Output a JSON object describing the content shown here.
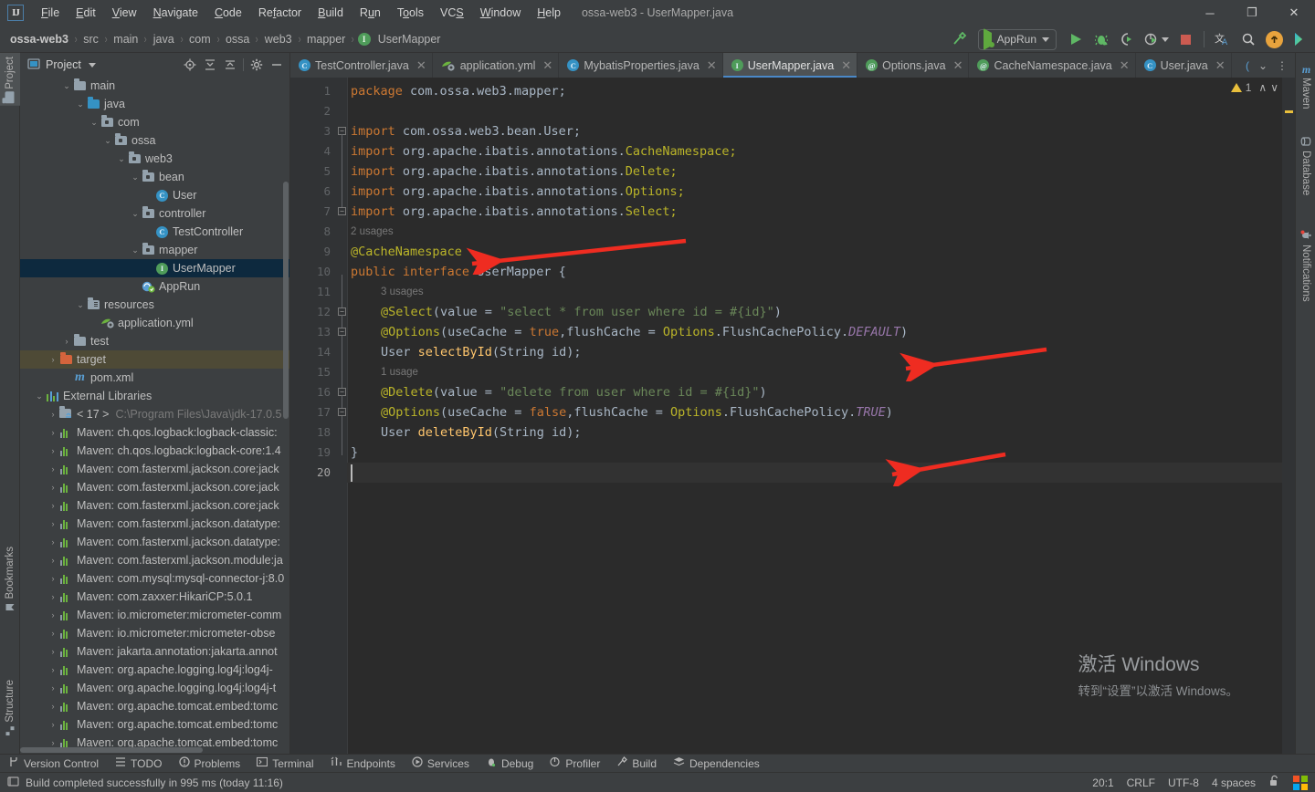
{
  "window": {
    "title": "ossa-web3 - UserMapper.java",
    "logo_text": "IJ",
    "minimize": "─",
    "maximize": "❐",
    "close": "✕"
  },
  "menu": [
    {
      "label": "File"
    },
    {
      "label": "Edit"
    },
    {
      "label": "View"
    },
    {
      "label": "Navigate"
    },
    {
      "label": "Code"
    },
    {
      "label": "Refactor"
    },
    {
      "label": "Build"
    },
    {
      "label": "Run"
    },
    {
      "label": "Tools"
    },
    {
      "label": "VCS"
    },
    {
      "label": "Window"
    },
    {
      "label": "Help"
    }
  ],
  "breadcrumb": {
    "items": [
      "ossa-web3",
      "src",
      "main",
      "java",
      "com",
      "ossa",
      "web3",
      "mapper"
    ],
    "last": "UserMapper",
    "last_icon": "I",
    "separator": "›"
  },
  "run_toolbar": {
    "build_icon": "hammer-icon",
    "config_name": "AppRun",
    "run_icon": "run-icon",
    "debug_icon": "debug-icon",
    "run_with_coverage_icon": "coverage-icon",
    "profile_icon": "profiler-icon",
    "stop_icon": "stop-icon",
    "translate_icon": "translate-icon",
    "search_icon": "search-icon",
    "update_icon": "update-icon",
    "ide_icon": "ide-icon"
  },
  "left_strip": [
    {
      "label": "Project",
      "icon": "project-icon",
      "active": true
    },
    {
      "label": "Bookmarks",
      "icon": "bookmark-icon",
      "active": false
    },
    {
      "label": "Structure",
      "icon": "structure-icon",
      "active": false
    }
  ],
  "right_strip": [
    {
      "label": "Maven",
      "icon": "maven-icon"
    },
    {
      "label": "Database",
      "icon": "database-icon"
    },
    {
      "label": "Notifications",
      "icon": "notifications-icon"
    }
  ],
  "project_pane": {
    "title": "Project",
    "icons": [
      "locate-icon",
      "expand-all-icon",
      "collapse-all-icon",
      "gear-icon",
      "hide-icon"
    ],
    "tree": [
      {
        "label": "main",
        "indent": 3,
        "chev": "⌄",
        "icon": "folder",
        "state": "normal"
      },
      {
        "label": "java",
        "indent": 4,
        "chev": "⌄",
        "icon": "folder-blue",
        "state": "normal"
      },
      {
        "label": "com",
        "indent": 5,
        "chev": "⌄",
        "icon": "folder-pkg",
        "state": "normal"
      },
      {
        "label": "ossa",
        "indent": 6,
        "chev": "⌄",
        "icon": "folder-pkg",
        "state": "normal"
      },
      {
        "label": "web3",
        "indent": 7,
        "chev": "⌄",
        "icon": "folder-pkg",
        "state": "normal"
      },
      {
        "label": "bean",
        "indent": 8,
        "chev": "⌄",
        "icon": "folder-pkg",
        "state": "normal"
      },
      {
        "label": "User",
        "indent": 9,
        "chev": "",
        "icon": "class",
        "state": "normal"
      },
      {
        "label": "controller",
        "indent": 8,
        "chev": "⌄",
        "icon": "folder-pkg",
        "state": "normal"
      },
      {
        "label": "TestController",
        "indent": 9,
        "chev": "",
        "icon": "class",
        "state": "normal"
      },
      {
        "label": "mapper",
        "indent": 8,
        "chev": "⌄",
        "icon": "folder-pkg",
        "state": "normal"
      },
      {
        "label": "UserMapper",
        "indent": 9,
        "chev": "",
        "icon": "interface",
        "state": "selected"
      },
      {
        "label": "AppRun",
        "indent": 8,
        "chev": "",
        "icon": "springboot",
        "state": "normal"
      },
      {
        "label": "resources",
        "indent": 4,
        "chev": "⌄",
        "icon": "folder-src",
        "state": "normal"
      },
      {
        "label": "application.yml",
        "indent": 5,
        "chev": "",
        "icon": "springyml",
        "state": "normal"
      },
      {
        "label": "test",
        "indent": 3,
        "chev": "›",
        "icon": "folder",
        "state": "normal"
      },
      {
        "label": "target",
        "indent": 2,
        "chev": "›",
        "icon": "folder-orange",
        "state": "highlight"
      },
      {
        "label": "pom.xml",
        "indent": 3,
        "chev": "",
        "icon": "maven-m",
        "state": "normal"
      },
      {
        "label": "External Libraries",
        "indent": 1,
        "chev": "⌄",
        "icon": "extlib",
        "state": "normal"
      },
      {
        "label": "< 17 >",
        "indent": 2,
        "chev": "›",
        "icon": "jdk",
        "state": "normal",
        "suffix": "C:\\Program Files\\Java\\jdk-17.0.5"
      },
      {
        "label": "Maven: ch.qos.logback:logback-classic:",
        "indent": 2,
        "chev": "›",
        "icon": "mvn",
        "state": "normal"
      },
      {
        "label": "Maven: ch.qos.logback:logback-core:1.4",
        "indent": 2,
        "chev": "›",
        "icon": "mvn",
        "state": "normal"
      },
      {
        "label": "Maven: com.fasterxml.jackson.core:jack",
        "indent": 2,
        "chev": "›",
        "icon": "mvn",
        "state": "normal"
      },
      {
        "label": "Maven: com.fasterxml.jackson.core:jack",
        "indent": 2,
        "chev": "›",
        "icon": "mvn",
        "state": "normal"
      },
      {
        "label": "Maven: com.fasterxml.jackson.core:jack",
        "indent": 2,
        "chev": "›",
        "icon": "mvn",
        "state": "normal"
      },
      {
        "label": "Maven: com.fasterxml.jackson.datatype:",
        "indent": 2,
        "chev": "›",
        "icon": "mvn",
        "state": "normal"
      },
      {
        "label": "Maven: com.fasterxml.jackson.datatype:",
        "indent": 2,
        "chev": "›",
        "icon": "mvn",
        "state": "normal"
      },
      {
        "label": "Maven: com.fasterxml.jackson.module:ja",
        "indent": 2,
        "chev": "›",
        "icon": "mvn",
        "state": "normal"
      },
      {
        "label": "Maven: com.mysql:mysql-connector-j:8.0",
        "indent": 2,
        "chev": "›",
        "icon": "mvn",
        "state": "normal"
      },
      {
        "label": "Maven: com.zaxxer:HikariCP:5.0.1",
        "indent": 2,
        "chev": "›",
        "icon": "mvn",
        "state": "normal"
      },
      {
        "label": "Maven: io.micrometer:micrometer-comm",
        "indent": 2,
        "chev": "›",
        "icon": "mvn",
        "state": "normal"
      },
      {
        "label": "Maven: io.micrometer:micrometer-obse",
        "indent": 2,
        "chev": "›",
        "icon": "mvn",
        "state": "normal"
      },
      {
        "label": "Maven: jakarta.annotation:jakarta.annot",
        "indent": 2,
        "chev": "›",
        "icon": "mvn",
        "state": "normal"
      },
      {
        "label": "Maven: org.apache.logging.log4j:log4j-",
        "indent": 2,
        "chev": "›",
        "icon": "mvn",
        "state": "normal"
      },
      {
        "label": "Maven: org.apache.logging.log4j:log4j-t",
        "indent": 2,
        "chev": "›",
        "icon": "mvn",
        "state": "normal"
      },
      {
        "label": "Maven: org.apache.tomcat.embed:tomc",
        "indent": 2,
        "chev": "›",
        "icon": "mvn",
        "state": "normal"
      },
      {
        "label": "Maven: org.apache.tomcat.embed:tomc",
        "indent": 2,
        "chev": "›",
        "icon": "mvn",
        "state": "normal"
      },
      {
        "label": "Maven: org.apache.tomcat.embed:tomc",
        "indent": 2,
        "chev": "›",
        "icon": "mvn",
        "state": "normal"
      }
    ]
  },
  "editor": {
    "tabs": [
      {
        "label": "TestController.java",
        "icon": "class",
        "active": false,
        "close": "✕"
      },
      {
        "label": "application.yml",
        "icon": "springyml",
        "active": false,
        "close": "✕"
      },
      {
        "label": "MybatisProperties.java",
        "icon": "class",
        "active": false,
        "close": "✕"
      },
      {
        "label": "UserMapper.java",
        "icon": "interface",
        "active": true,
        "close": "✕"
      },
      {
        "label": "Options.java",
        "icon": "annotation",
        "active": false,
        "close": "✕"
      },
      {
        "label": "CacheNamespace.java",
        "icon": "annotation",
        "active": false,
        "close": "✕"
      },
      {
        "label": "User.java",
        "icon": "class",
        "active": false,
        "close": "✕"
      }
    ],
    "tab_overflow": "⌄",
    "tab_more": "⋮",
    "inspection": {
      "warning_count": "1",
      "up": "∧",
      "down": "∨"
    },
    "line_numbers": [
      "1",
      "2",
      "3",
      "4",
      "5",
      "6",
      "7",
      "8",
      "9",
      "10",
      "11",
      "12",
      "13",
      "14",
      "15",
      "16",
      "17",
      "18",
      "19",
      "20"
    ],
    "current_line": 20,
    "usage_hints": [
      {
        "text": "2 usages",
        "line": 8,
        "indent": 0
      },
      {
        "text": "3 usages",
        "line": 11,
        "indent": 1
      },
      {
        "text": "1 usage",
        "line": 15,
        "indent": 1
      }
    ],
    "lines": [
      {
        "n": 1,
        "tokens": [
          {
            "t": "package ",
            "c": "kw"
          },
          {
            "t": "com.ossa.web3.mapper;",
            "c": "ident"
          }
        ]
      },
      {
        "n": 2,
        "tokens": []
      },
      {
        "n": 3,
        "tokens": [
          {
            "t": "import ",
            "c": "kw"
          },
          {
            "t": "com.ossa.web3.bean.",
            "c": "ident"
          },
          {
            "t": "User;",
            "c": "ident"
          }
        ]
      },
      {
        "n": 4,
        "tokens": [
          {
            "t": "import ",
            "c": "kw"
          },
          {
            "t": "org.apache.ibatis.annotations.",
            "c": "ident"
          },
          {
            "t": "CacheNamespace;",
            "c": "anno"
          }
        ]
      },
      {
        "n": 5,
        "tokens": [
          {
            "t": "import ",
            "c": "kw"
          },
          {
            "t": "org.apache.ibatis.annotations.",
            "c": "ident"
          },
          {
            "t": "Delete;",
            "c": "anno"
          }
        ]
      },
      {
        "n": 6,
        "tokens": [
          {
            "t": "import ",
            "c": "kw"
          },
          {
            "t": "org.apache.ibatis.annotations.",
            "c": "ident"
          },
          {
            "t": "Options;",
            "c": "anno"
          }
        ]
      },
      {
        "n": 7,
        "tokens": [
          {
            "t": "import ",
            "c": "kw"
          },
          {
            "t": "org.apache.ibatis.annotations.",
            "c": "ident"
          },
          {
            "t": "Select;",
            "c": "anno"
          }
        ]
      },
      {
        "n": 8,
        "tokens": []
      },
      {
        "n": 9,
        "tokens": [
          {
            "t": "@CacheNamespace",
            "c": "anno"
          }
        ]
      },
      {
        "n": 10,
        "tokens": [
          {
            "t": "public ",
            "c": "kw"
          },
          {
            "t": "interface ",
            "c": "kw"
          },
          {
            "t": "UserMapper ",
            "c": "ident"
          },
          {
            "t": "{",
            "c": "ident"
          }
        ]
      },
      {
        "n": 11,
        "tokens": []
      },
      {
        "n": 12,
        "indent": 1,
        "tokens": [
          {
            "t": "@Select",
            "c": "anno"
          },
          {
            "t": "(value = ",
            "c": "ident"
          },
          {
            "t": "\"select * from user where id = #{id}\"",
            "c": "str"
          },
          {
            "t": ")",
            "c": "ident"
          }
        ]
      },
      {
        "n": 13,
        "indent": 1,
        "tokens": [
          {
            "t": "@Options",
            "c": "anno"
          },
          {
            "t": "(useCache = ",
            "c": "ident"
          },
          {
            "t": "true",
            "c": "kw"
          },
          {
            "t": ",flushCache = ",
            "c": "ident"
          },
          {
            "t": "Options",
            "c": "anno"
          },
          {
            "t": ".FlushCachePolicy.",
            "c": "ident"
          },
          {
            "t": "DEFAULT",
            "c": "stat"
          },
          {
            "t": ")",
            "c": "ident"
          }
        ]
      },
      {
        "n": 14,
        "indent": 1,
        "tokens": [
          {
            "t": "User ",
            "c": "ident"
          },
          {
            "t": "selectById",
            "c": "mth"
          },
          {
            "t": "(String id);",
            "c": "ident"
          }
        ]
      },
      {
        "n": 15,
        "tokens": []
      },
      {
        "n": 16,
        "indent": 1,
        "tokens": [
          {
            "t": "@Delete",
            "c": "anno"
          },
          {
            "t": "(value = ",
            "c": "ident"
          },
          {
            "t": "\"delete from user where id = #{id}\"",
            "c": "str"
          },
          {
            "t": ")",
            "c": "ident"
          }
        ]
      },
      {
        "n": 17,
        "indent": 1,
        "tokens": [
          {
            "t": "@Options",
            "c": "anno"
          },
          {
            "t": "(useCache = ",
            "c": "ident"
          },
          {
            "t": "false",
            "c": "kw"
          },
          {
            "t": ",flushCache = ",
            "c": "ident"
          },
          {
            "t": "Options",
            "c": "anno"
          },
          {
            "t": ".FlushCachePolicy.",
            "c": "ident"
          },
          {
            "t": "TRUE",
            "c": "stat"
          },
          {
            "t": ")",
            "c": "ident"
          }
        ]
      },
      {
        "n": 18,
        "indent": 1,
        "tokens": [
          {
            "t": "User ",
            "c": "ident"
          },
          {
            "t": "deleteById",
            "c": "mth"
          },
          {
            "t": "(String id);",
            "c": "ident"
          }
        ]
      },
      {
        "n": 19,
        "tokens": [
          {
            "t": "}",
            "c": "ident"
          }
        ]
      },
      {
        "n": 20,
        "tokens": []
      }
    ],
    "annotations": {
      "arrow_color": "#ef2c21",
      "arrows": [
        {
          "name": "arrow-cachenamespace",
          "target_line": 9
        },
        {
          "name": "arrow-options-default",
          "target_line": 13
        },
        {
          "name": "arrow-options-true",
          "target_line": 17
        }
      ]
    }
  },
  "watermark": {
    "line1": "激活 Windows",
    "line2": "转到“设置”以激活 Windows。"
  },
  "bottom_bar": [
    {
      "label": "Version Control",
      "icon": "branch-icon"
    },
    {
      "label": "TODO",
      "icon": "todo-icon"
    },
    {
      "label": "Problems",
      "icon": "problems-icon"
    },
    {
      "label": "Terminal",
      "icon": "terminal-icon"
    },
    {
      "label": "Endpoints",
      "icon": "endpoints-icon"
    },
    {
      "label": "Services",
      "icon": "services-icon"
    },
    {
      "label": "Debug",
      "icon": "debug-icon"
    },
    {
      "label": "Profiler",
      "icon": "profiler-icon"
    },
    {
      "label": "Build",
      "icon": "build-icon"
    },
    {
      "label": "Dependencies",
      "icon": "dependencies-icon"
    }
  ],
  "status_bar": {
    "message": "Build completed successfully in 995 ms (today 11:16)",
    "message_icon": "console-icon",
    "caret_position": "20:1",
    "line_separator": "CRLF",
    "encoding": "UTF-8",
    "indent": "4 spaces",
    "lock_icon": "unlocked-icon",
    "os_logo": "windows-logo"
  }
}
